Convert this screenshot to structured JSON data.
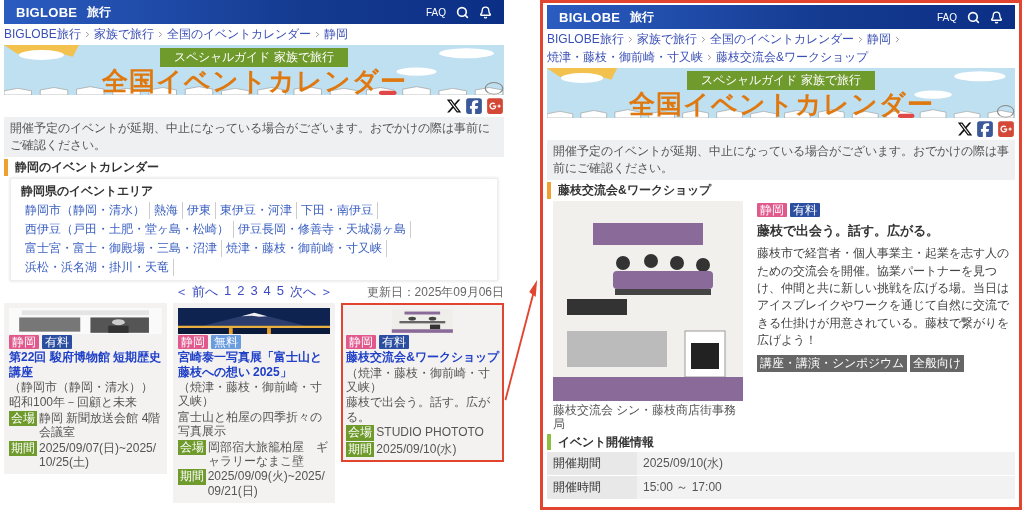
{
  "left_page": {
    "header": {
      "logo": "BIGLOBE",
      "logo_sub": "旅行",
      "faq": "FAQ"
    },
    "breadcrumb": [
      "BIGLOBE旅行",
      "家族で旅行",
      "全国のイベントカレンダー",
      "静岡"
    ],
    "banner": {
      "subtitle": "スペシャルガイド 家族で旅行",
      "title": "全国イベントカレンダー"
    },
    "notice": "開催予定のイベントが延期、中止になっている場合がございます。おでかけの際は事前にご確認ください。",
    "section_title": "静岡のイベントカレンダー",
    "area_box": {
      "title": "静岡県のイベントエリア",
      "links": [
        "静岡市（静岡・清水）",
        "熱海",
        "伊東",
        "東伊豆・河津",
        "下田・南伊豆",
        "西伊豆（戸田・土肥・堂ヶ島・松崎）",
        "伊豆長岡・修善寺・天城湯ヶ島",
        "富士宮・富士・御殿場・三島・沼津",
        "焼津・藤枝・御前崎・寸又峡",
        "浜松・浜名湖・掛川・天竜"
      ]
    },
    "pagination": {
      "prev": "＜ 前へ",
      "pages": [
        "1",
        "2",
        "3",
        "4",
        "5"
      ],
      "next": "次へ ＞"
    },
    "updated": "更新日：2025年09月06日",
    "cards": [
      {
        "highlighted": false,
        "tags": [
          {
            "label": "静岡",
            "color": "#e0588c"
          },
          {
            "label": "有料",
            "color": "#2b4ea0"
          }
        ],
        "title": "第22回 駿府博物館 短期歴史講座",
        "area": "（静岡市（静岡・清水））",
        "summary": "昭和100年－回顧と未来",
        "venue_label": "会場",
        "venue": "静岡 新聞放送会館 4階会議室",
        "period_label": "期間",
        "period": "2025/09/07(日)~2025/10/25(土)"
      },
      {
        "highlighted": false,
        "tags": [
          {
            "label": "静岡",
            "color": "#e0588c"
          },
          {
            "label": "無料",
            "color": "#6a9ce0"
          }
        ],
        "title": "宮崎泰一写真展「富士山と藤枝への想い 2025」",
        "area": "（焼津・藤枝・御前崎・寸又峡）",
        "summary": "富士山と柏屋の四季折々の写真展示",
        "venue_label": "会場",
        "venue": "岡部宿大旅籠柏屋　ギャラリーなまこ壁",
        "period_label": "期間",
        "period": "2025/09/09(火)~2025/09/21(日)"
      },
      {
        "highlighted": true,
        "tags": [
          {
            "label": "静岡",
            "color": "#e0588c"
          },
          {
            "label": "有料",
            "color": "#2b4ea0"
          }
        ],
        "title": "藤枝交流会&ワークショップ",
        "area": "（焼津・藤枝・御前崎・寸又峡）",
        "summary": "藤枝で出会う。話す。広がる。",
        "venue_label": "会場",
        "venue": "STUDIO PHOTOTO",
        "period_label": "期間",
        "period": "2025/09/10(水)"
      }
    ]
  },
  "detail_page": {
    "highlighted": true,
    "header": {
      "logo": "BIGLOBE",
      "logo_sub": "旅行",
      "faq": "FAQ"
    },
    "breadcrumb": [
      "BIGLOBE旅行",
      "家族で旅行",
      "全国のイベントカレンダー",
      "静岡",
      "焼津・藤枝・御前崎・寸又峡",
      "藤枝交流会&ワークショップ"
    ],
    "banner": {
      "subtitle": "スペシャルガイド 家族で旅行",
      "title": "全国イベントカレンダー"
    },
    "notice": "開催予定のイベントが延期、中止になっている場合がございます。おでかけの際は事前にご確認ください。",
    "section_title": "藤枝交流会&ワークショップ",
    "caption": "藤枝交流会 シン・藤枝商店街事務局",
    "tags": [
      {
        "label": "静岡",
        "color": "#e0588c"
      },
      {
        "label": "有料",
        "color": "#2b4ea0"
      }
    ],
    "subtitle": "藤枝で出会う。話す。広がる。",
    "description": "藤枝市で経営者・個人事業主・起業を志す人のための交流会を開催。協業パートナーを見つけ、仲間と共に新しい挑戦を広げる場。当日はアイスブレイクやワークを通じて自然に交流できる仕掛けが用意されている。藤枝で繋がりを広げよう！",
    "categories": [
      "講座・講演・シンポジウム",
      "全般向け"
    ],
    "info_title": "イベント開催情報",
    "info_rows": [
      {
        "label": "開催期間",
        "value": "2025/09/10(水)"
      },
      {
        "label": "開催時間",
        "value": "15:00 ～ 17:00"
      }
    ]
  }
}
